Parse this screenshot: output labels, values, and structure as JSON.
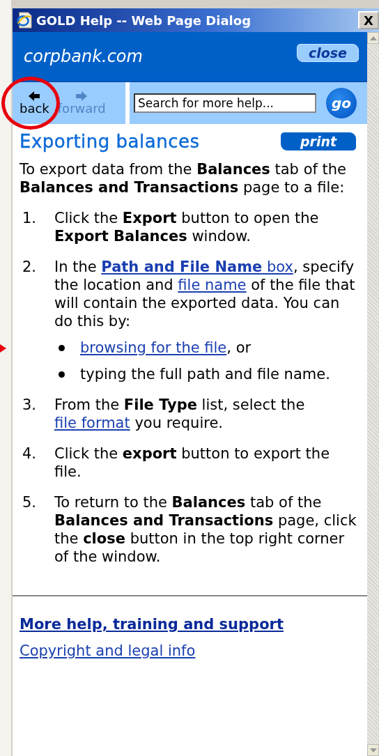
{
  "window": {
    "title": "GOLD Help -- Web Page Dialog",
    "close_glyph": "X"
  },
  "header": {
    "brand": "corpbank.com",
    "close_button": "close"
  },
  "nav": [
    {
      "label": "back",
      "disabled": false,
      "highlighted": true
    },
    {
      "label": "forward",
      "disabled": true,
      "highlighted": false
    }
  ],
  "search": {
    "placeholder": "Search for more help...",
    "button": "go"
  },
  "article": {
    "title": "Exporting balances",
    "print_button": "print",
    "intro": [
      {
        "kind": "plain",
        "text": "To export data from the "
      },
      {
        "kind": "bold",
        "text": "Balances"
      },
      {
        "kind": "plain",
        "text": " tab of the "
      },
      {
        "kind": "bold",
        "text": "Balances and Transactions"
      },
      {
        "kind": "plain",
        "text": " page to a file:"
      }
    ],
    "steps": [
      {
        "number": "1.",
        "parts": [
          {
            "kind": "plain",
            "text": "Click the "
          },
          {
            "kind": "bold",
            "text": "Export"
          },
          {
            "kind": "plain",
            "text": " button to open the "
          },
          {
            "kind": "bold",
            "text": "Export Balances"
          },
          {
            "kind": "plain",
            "text": " window."
          }
        ]
      },
      {
        "number": "2.",
        "parts": [
          {
            "kind": "plain",
            "text": "In the "
          },
          {
            "kind": "boldlink",
            "text": "Path and File Name"
          },
          {
            "kind": "link",
            "text": " box"
          },
          {
            "kind": "plain",
            "text": ", specify the location and "
          },
          {
            "kind": "link",
            "text": "file name"
          },
          {
            "kind": "plain",
            "text": " of the file that will contain the exported data. You can do this by:"
          }
        ],
        "bullets": [
          {
            "marked": true,
            "parts": [
              {
                "kind": "link",
                "text": "browsing for the file"
              },
              {
                "kind": "plain",
                "text": ", or"
              }
            ]
          },
          {
            "marked": false,
            "parts": [
              {
                "kind": "plain",
                "text": "typing the full path and file name."
              }
            ]
          }
        ]
      },
      {
        "number": "3.",
        "parts": [
          {
            "kind": "plain",
            "text": "From the "
          },
          {
            "kind": "bold",
            "text": "File Type"
          },
          {
            "kind": "plain",
            "text": " list, select the "
          },
          {
            "kind": "link",
            "text": "file format"
          },
          {
            "kind": "plain",
            "text": " you require."
          }
        ]
      },
      {
        "number": "4.",
        "parts": [
          {
            "kind": "plain",
            "text": "Click the "
          },
          {
            "kind": "bold",
            "text": "export"
          },
          {
            "kind": "plain",
            "text": " button to export the file."
          }
        ]
      },
      {
        "number": "5.",
        "parts": [
          {
            "kind": "plain",
            "text": "To return to the "
          },
          {
            "kind": "bold",
            "text": "Balances"
          },
          {
            "kind": "plain",
            "text": " tab of the "
          },
          {
            "kind": "bold",
            "text": "Balances and Transactions"
          },
          {
            "kind": "plain",
            "text": " page, click the "
          },
          {
            "kind": "bold",
            "text": "close"
          },
          {
            "kind": "plain",
            "text": " button in the top right corner of the window."
          }
        ]
      }
    ]
  },
  "footer_links": [
    {
      "kind": "bold",
      "text": "More help, training and support"
    },
    {
      "kind": "plain",
      "text": "Copyright and legal info"
    }
  ]
}
